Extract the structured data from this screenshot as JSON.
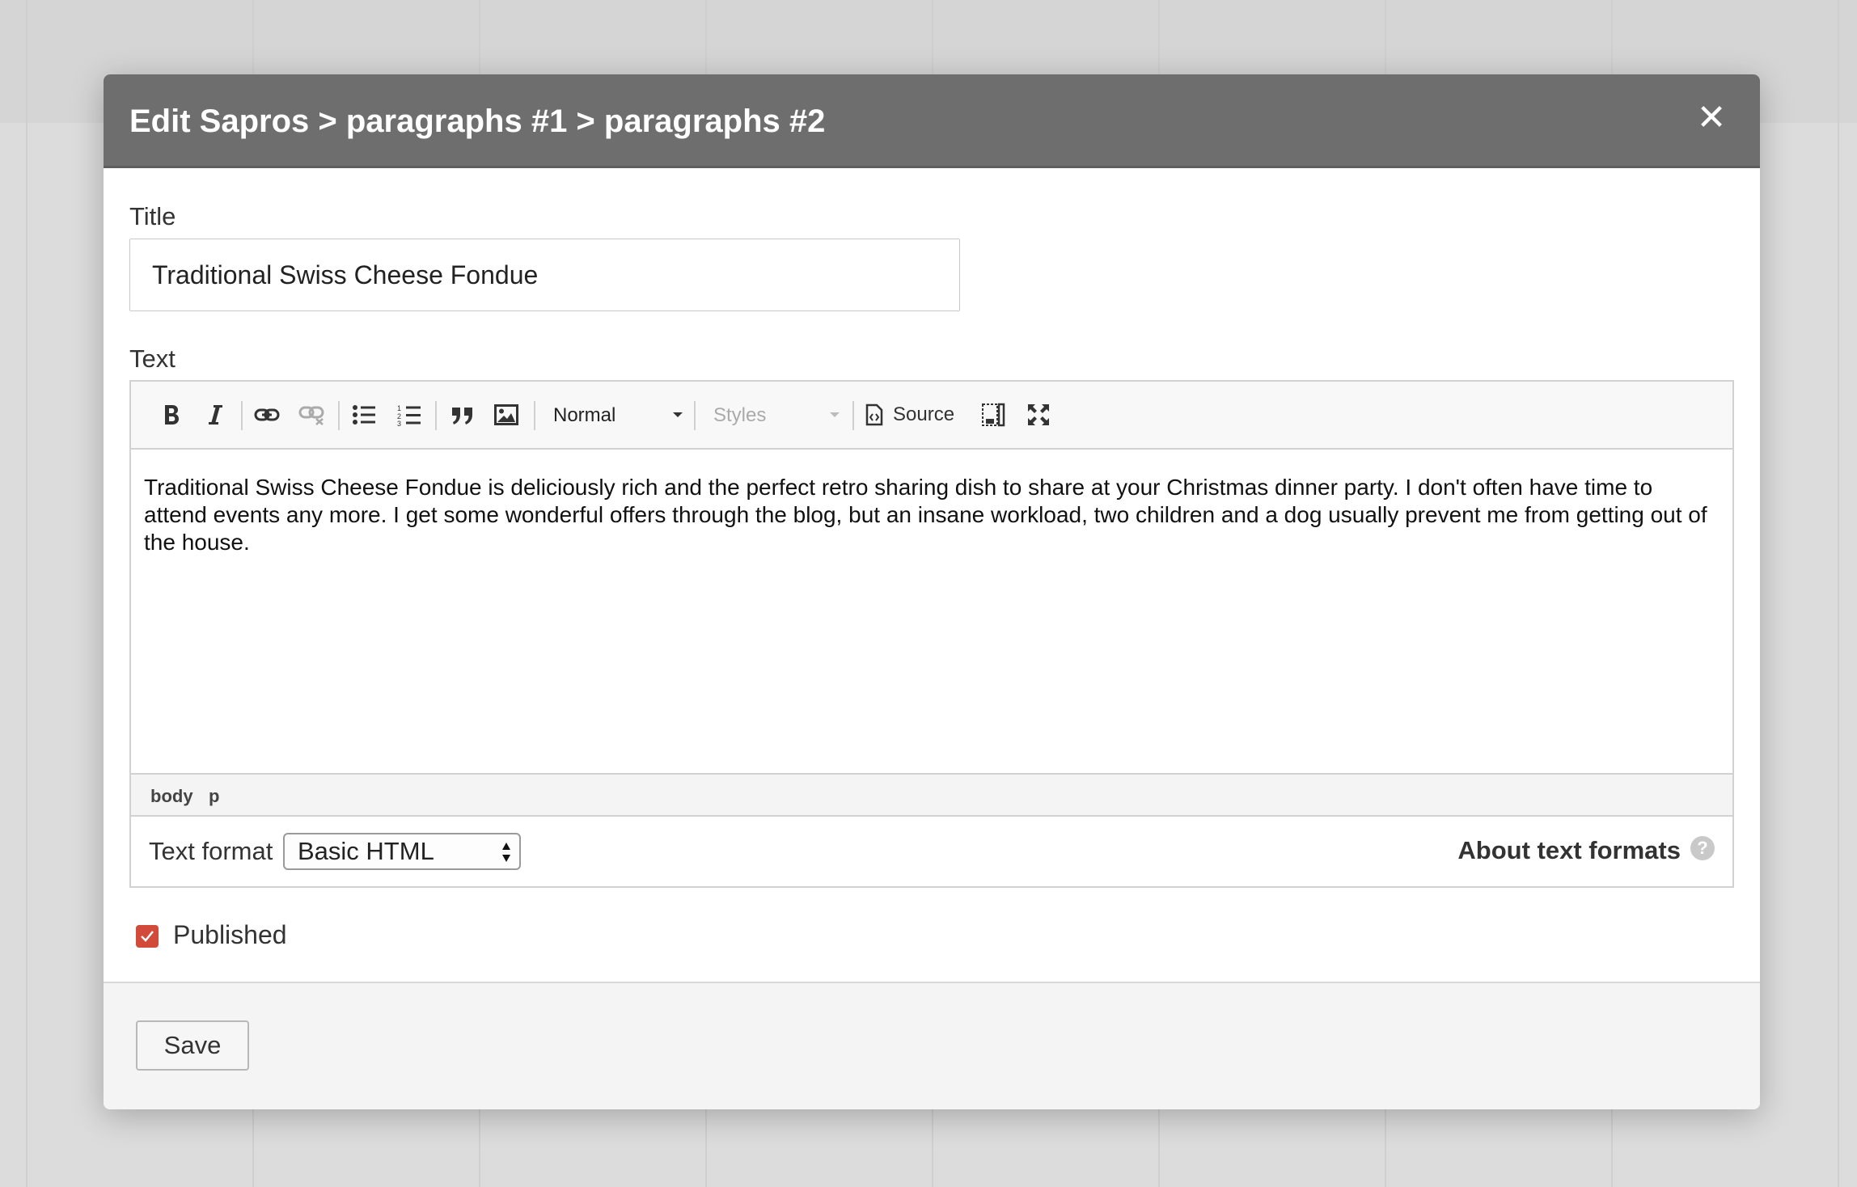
{
  "dialog": {
    "title": "Edit Sapros > paragraphs #1 > paragraphs #2",
    "close_glyph": "✕"
  },
  "form": {
    "title_label": "Title",
    "title_value": "Traditional Swiss Cheese Fondue",
    "text_label": "Text"
  },
  "toolbar": {
    "format_combo": "Normal",
    "styles_combo": "Styles",
    "source_label": "Source",
    "icons": [
      "bold-icon",
      "italic-icon",
      "link-icon",
      "unlink-icon",
      "bulleted-list-icon",
      "numbered-list-icon",
      "blockquote-icon",
      "image-icon",
      "source-icon",
      "show-blocks-icon",
      "maximize-icon"
    ]
  },
  "editor": {
    "content": "Traditional Swiss Cheese Fondue is deliciously rich and the perfect retro sharing dish to share at your Christmas dinner party. I don't often have time to attend events any more. I get some wonderful offers through the blog, but an insane workload, two children and a dog usually prevent me from getting out of the house.",
    "path": [
      "body",
      "p"
    ]
  },
  "text_format": {
    "label": "Text format",
    "selected": "Basic HTML",
    "about_link": "About text formats",
    "help_glyph": "?"
  },
  "published": {
    "label": "Published",
    "checked": true
  },
  "footer": {
    "save_label": "Save"
  },
  "colors": {
    "header_bg": "#6e6e6e",
    "checkbox_accent": "#d24a3a"
  }
}
